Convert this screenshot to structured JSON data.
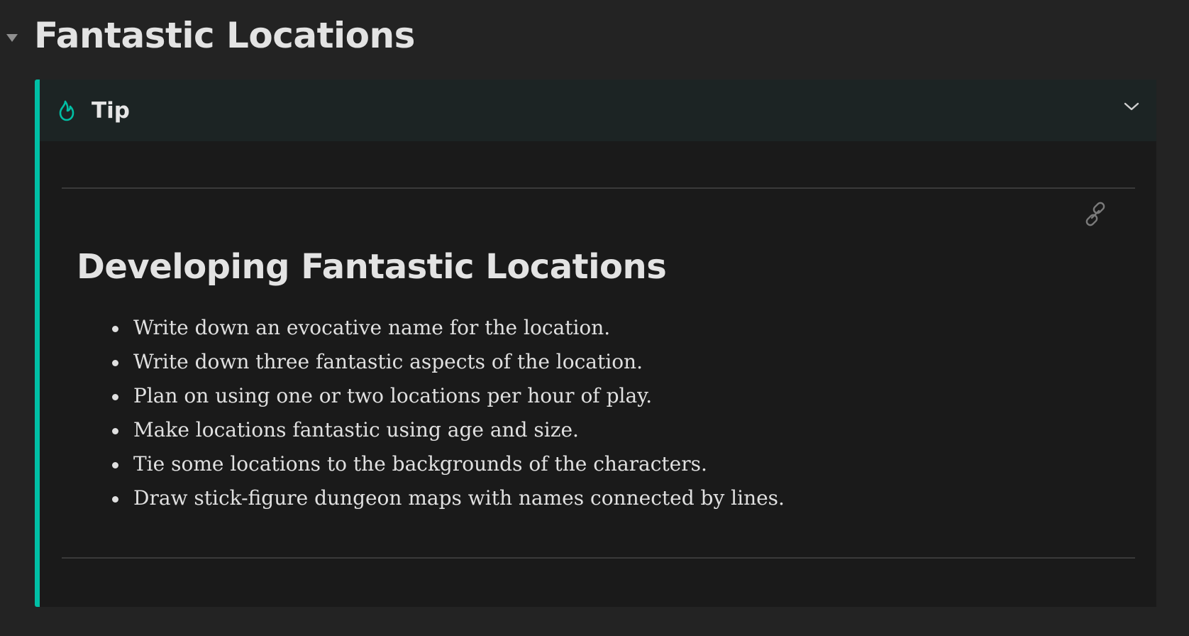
{
  "page": {
    "heading": "Fantastic Locations"
  },
  "callout": {
    "type": "Tip",
    "title": "Tip",
    "icon": "flame-icon",
    "accent_color": "#00bfa5",
    "collapse_icon": "chevron-down-icon"
  },
  "content": {
    "link_icon": "link-icon",
    "heading": "Developing Fantastic Locations",
    "bullets": [
      "Write down an evocative name for the location.",
      "Write down three fantastic aspects of the location.",
      "Plan on using one or two locations per hour of play.",
      "Make locations fantastic using age and size.",
      "Tie some locations to the backgrounds of the characters.",
      "Draw stick-figure dungeon maps with names connected by lines."
    ]
  },
  "colors": {
    "background": "#232323",
    "callout_body": "#1a1a1a",
    "callout_header": "#1c2424",
    "text": "#e0e0e0"
  }
}
